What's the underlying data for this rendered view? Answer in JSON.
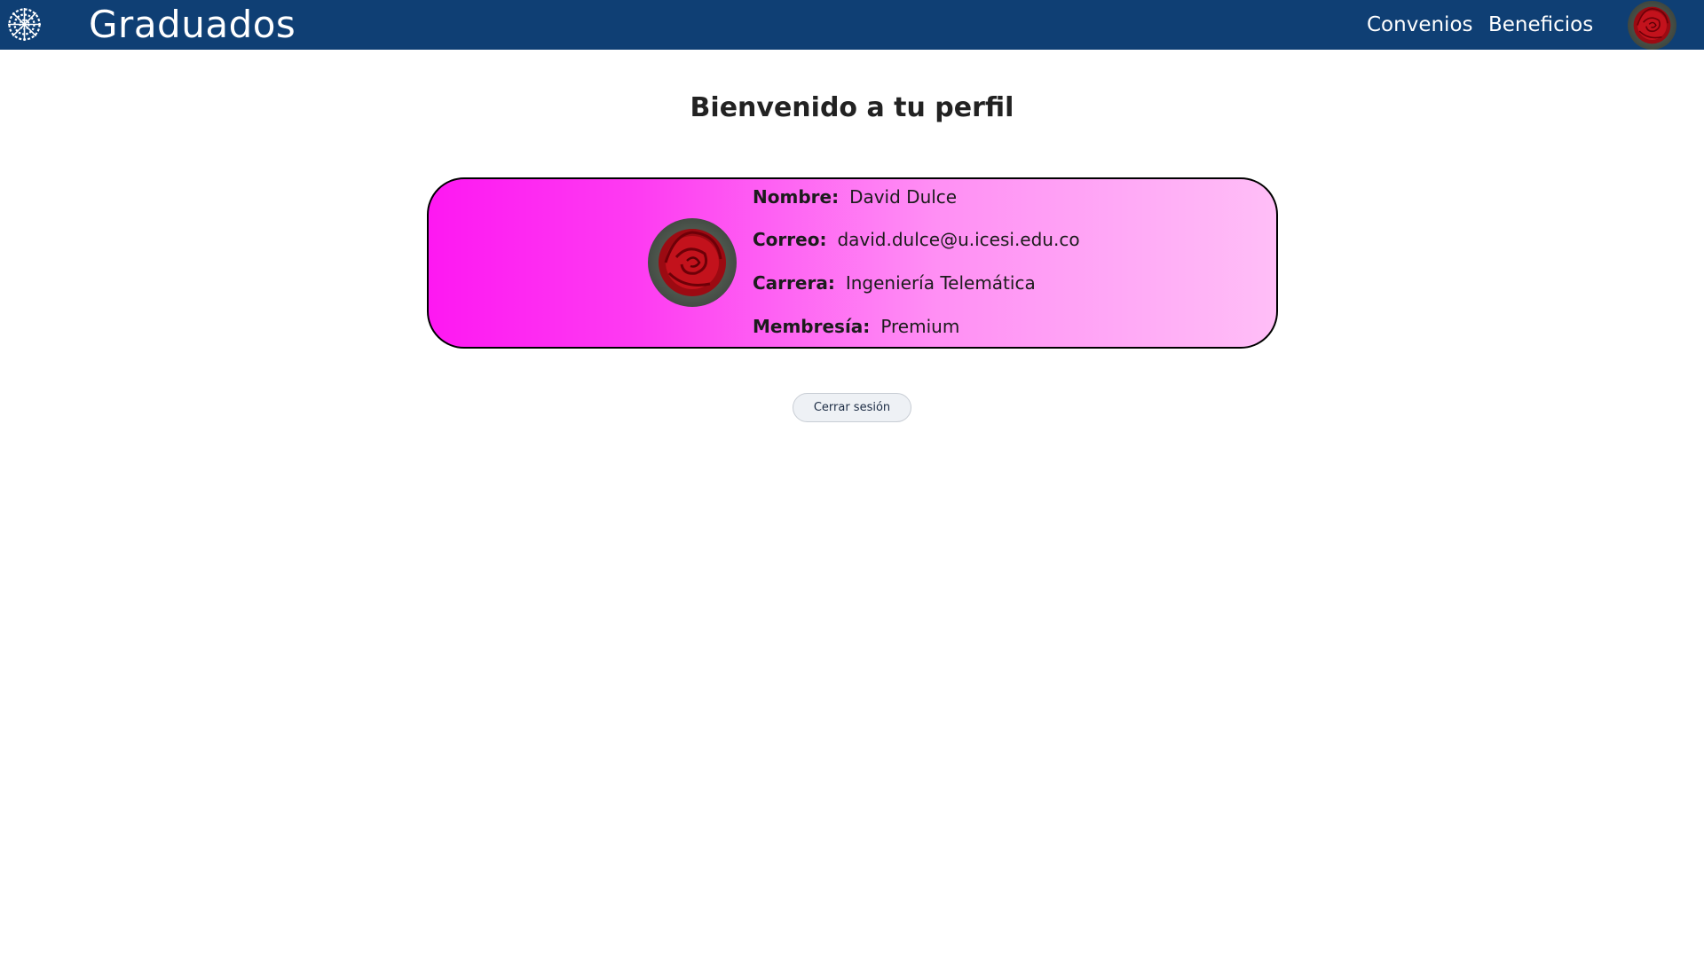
{
  "header": {
    "title": "Graduados",
    "nav": [
      {
        "label": "Convenios"
      },
      {
        "label": "Beneficios"
      }
    ],
    "logo_icon": "university-seal-icon",
    "brand_color": "#0f3f74"
  },
  "main": {
    "title": "Bienvenido a tu perfil",
    "profile": {
      "fields": [
        {
          "label": "Nombre:",
          "value": "David Dulce"
        },
        {
          "label": "Correo:",
          "value": "david.dulce@u.icesi.edu.co"
        },
        {
          "label": "Carrera:",
          "value": "Ingeniería Telemática"
        },
        {
          "label": "Membresía:",
          "value": "Premium"
        }
      ],
      "gradient_start": "#fe18f2",
      "gradient_end": "#ffbef7"
    },
    "logout_label": "Cerrar sesión"
  }
}
